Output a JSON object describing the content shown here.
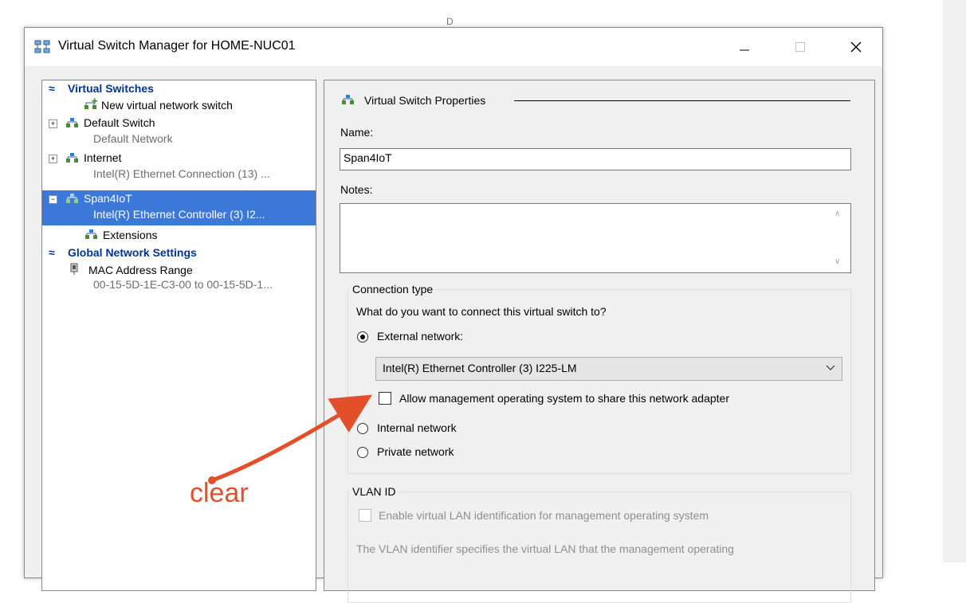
{
  "window": {
    "title": "Virtual Switch Manager for HOME-NUC01"
  },
  "background": {
    "partial_title": "D"
  },
  "tree": {
    "virtual_switches_header": "Virtual Switches",
    "new_switch": "New virtual network switch",
    "default_switch": {
      "name": "Default Switch",
      "sub": "Default Network"
    },
    "internet": {
      "name": "Internet",
      "sub": "Intel(R) Ethernet Connection (13) ..."
    },
    "span4iot": {
      "name": "Span4IoT",
      "sub": "Intel(R) Ethernet Controller (3) I2..."
    },
    "extensions": "Extensions",
    "global_header": "Global Network Settings",
    "mac_range": {
      "name": "MAC Address Range",
      "sub": "00-15-5D-1E-C3-00 to 00-15-5D-1..."
    }
  },
  "props": {
    "section_title": "Virtual Switch Properties",
    "name_label": "Name:",
    "name_value": "Span4IoT",
    "notes_label": "Notes:",
    "notes_value": "",
    "connection_type": {
      "title": "Connection type",
      "question": "What do you want to connect this virtual switch to?",
      "external_label": "External network:",
      "external_selected": true,
      "adapter_value": "Intel(R) Ethernet Controller (3) I225-LM",
      "allow_mgmt_label": "Allow management operating system to share this network adapter",
      "allow_mgmt_checked": false,
      "internal_label": "Internal network",
      "private_label": "Private network"
    },
    "vlan": {
      "title": "VLAN ID",
      "enable_label": "Enable virtual LAN identification for management operating system",
      "description": "The VLAN identifier specifies the virtual LAN that the management operating"
    }
  },
  "annotation": {
    "text": "clear",
    "color": "#e2502b"
  },
  "colors": {
    "selection": "#3b78d8",
    "section_header": "#003399"
  }
}
